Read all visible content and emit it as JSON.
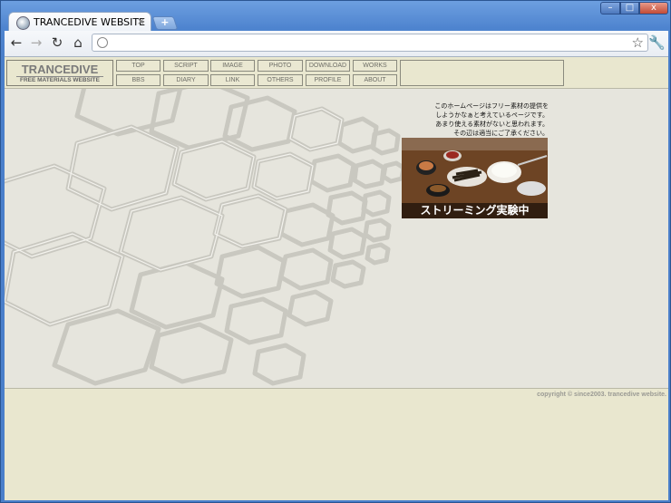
{
  "browser": {
    "tab_title": "TRANCEDIVE WEBSITE",
    "tab_close": "×",
    "new_tab": "+",
    "url": "",
    "window_controls": {
      "minimize": "–",
      "maximize": "□",
      "close": "x"
    }
  },
  "site": {
    "logo_title": "TRANCEDIVE",
    "logo_subtitle": "FREE MATERIALS WEBSITE",
    "nav_top": [
      "TOP",
      "SCRIPT",
      "IMAGE",
      "PHOTO",
      "DOWNLOAD",
      "WORKS"
    ],
    "nav_bottom": [
      "BBS",
      "DIARY",
      "LINK",
      "OTHERS",
      "PROFILE",
      "ABOUT"
    ],
    "notice_lines": [
      "このホームページはフリー素材の提供を",
      "しようかなぁと考えているページです。",
      "あまり使える素材がないと思われます。",
      "その辺は適当にご了承ください。"
    ],
    "photo_caption": "ストリーミング実験中",
    "copyright": "copyright ©  since2003. trancedive website."
  },
  "colors": {
    "header_bg": "#e9e7cf",
    "page_bg": "#e6e5dd",
    "chrome_blue": "#4a7fca"
  }
}
